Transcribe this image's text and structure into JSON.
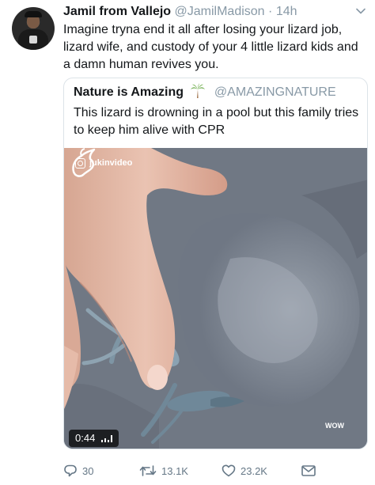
{
  "tweet": {
    "author_name": "Jamil from Vallejo",
    "author_handle": "@JamilMadison",
    "separator": "·",
    "time": "14h",
    "text": "Imagine tryna end it all after losing your lizard job, lizard wife, and custody of your 4 little lizard kids and a damn human revives you.",
    "avatar_icon": "profile-photo"
  },
  "quoted_tweet": {
    "author_name": "Nature is Amazing",
    "author_emoji_icon": "palm-tree-icon",
    "author_handle": "@AMAZINGNATURE",
    "text": "This lizard is drowning in a pool but this family tries to keep him alive with CPR",
    "video": {
      "watermark": "jukinvideo",
      "watermark_icon": "instagram-icon",
      "duration": "0:44",
      "volume_icon": "volume-bars-icon",
      "brand_label": "WOW",
      "brand_icon": "goat-icon"
    }
  },
  "actions": {
    "reply_count": "30",
    "retweet_count": "13.1K",
    "like_count": "23.2K",
    "reply_icon": "reply-icon",
    "retweet_icon": "retweet-icon",
    "like_icon": "heart-icon",
    "dm_icon": "envelope-icon"
  },
  "colors": {
    "text": "#14171a",
    "secondary": "#8899a6",
    "action": "#657786",
    "border": "#dce3e8"
  }
}
